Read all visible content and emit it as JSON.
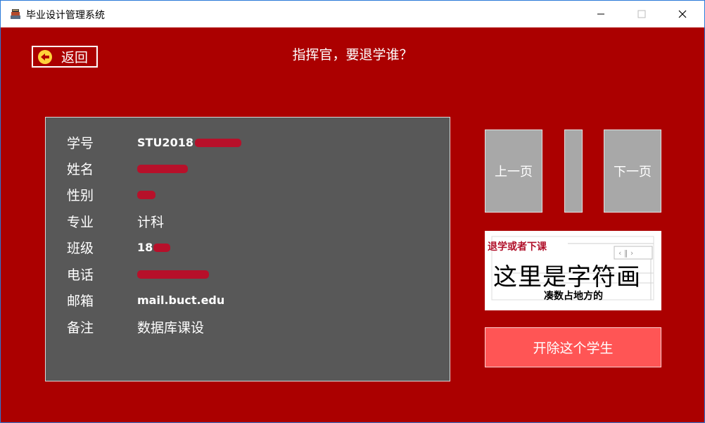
{
  "window": {
    "title": "毕业设计管理系统",
    "minimize_glyph": "—",
    "maximize_glyph": "☐",
    "close_glyph": "✕"
  },
  "toolbar": {
    "back_label": "返回",
    "back_icon": "arrow-left-icon"
  },
  "prompt_text": "指挥官，要退学谁？",
  "student": {
    "fields": [
      {
        "label": "学号",
        "value": "STU2018",
        "redacted": true
      },
      {
        "label": "姓名",
        "value": "",
        "redacted": true
      },
      {
        "label": "性别",
        "value": "",
        "redacted": true
      },
      {
        "label": "专业",
        "value": "计科",
        "redacted": false
      },
      {
        "label": "班级",
        "value": "18",
        "redacted": true
      },
      {
        "label": "电话",
        "value": "",
        "redacted": true
      },
      {
        "label": "邮箱",
        "value": "mail.buct.edu",
        "redacted": false
      },
      {
        "label": "备注",
        "value": "数据库课设",
        "redacted": false
      }
    ]
  },
  "nav": {
    "prev_label": "上一页",
    "next_label": "下一页"
  },
  "picture": {
    "sub_caption": "退学或者下课",
    "main_caption": "这里是字符画",
    "bottom_caption": "凑数占地方的"
  },
  "action": {
    "expel_label": "开除这个学生"
  },
  "colors": {
    "background": "#ab0000",
    "card": "#585858",
    "nav_button": "#a8a8a8",
    "expel_button": "#ff5555",
    "redaction": "#b7102a"
  }
}
